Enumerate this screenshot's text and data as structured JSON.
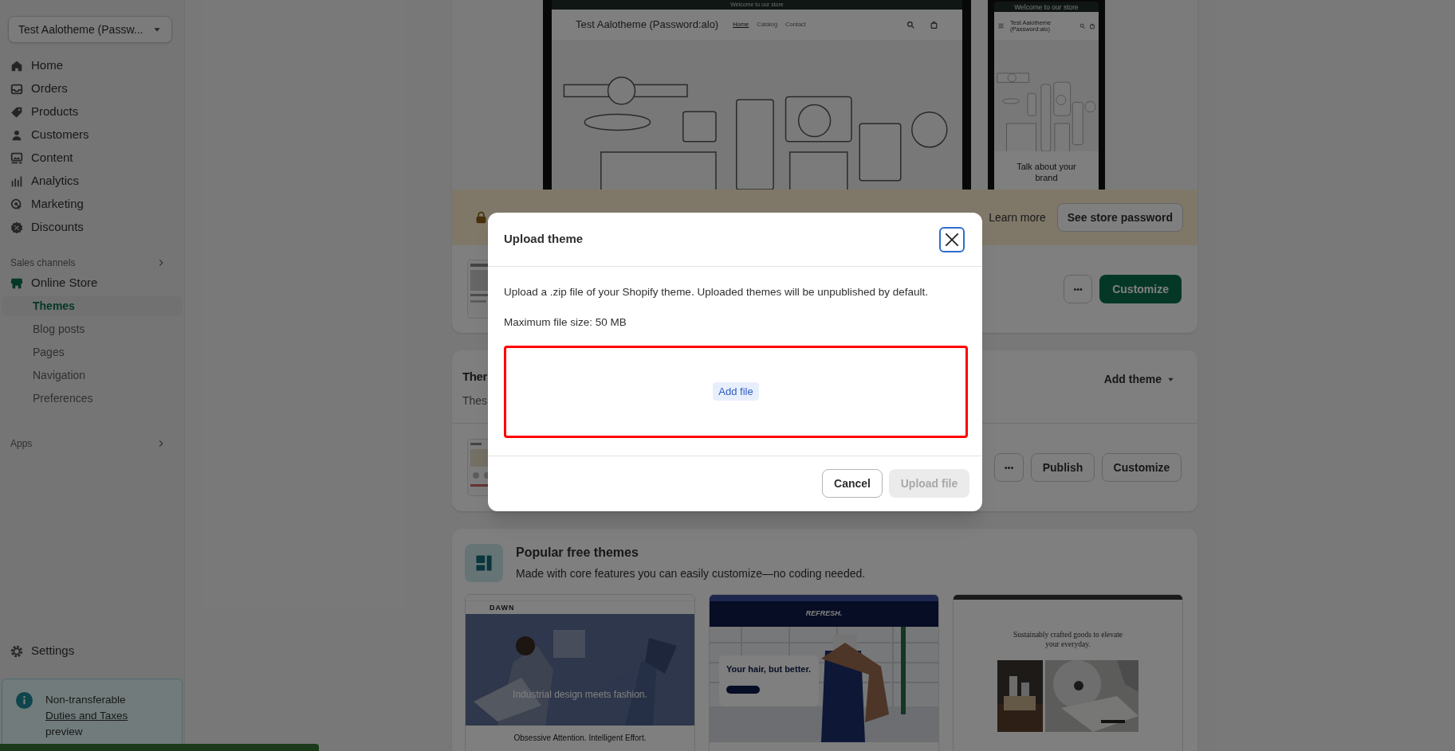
{
  "store_switcher": {
    "label": "Test Aalotheme (Passw..."
  },
  "nav": [
    {
      "label": "Home"
    },
    {
      "label": "Orders"
    },
    {
      "label": "Products"
    },
    {
      "label": "Customers"
    },
    {
      "label": "Content"
    },
    {
      "label": "Analytics"
    },
    {
      "label": "Marketing"
    },
    {
      "label": "Discounts"
    }
  ],
  "sales_channels": {
    "label": "Sales channels",
    "channel": "Online Store",
    "items": [
      {
        "label": "Themes",
        "selected": true
      },
      {
        "label": "Blog posts",
        "selected": false
      },
      {
        "label": "Pages",
        "selected": false
      },
      {
        "label": "Navigation",
        "selected": false
      },
      {
        "label": "Preferences",
        "selected": false
      }
    ]
  },
  "apps": {
    "label": "Apps"
  },
  "settings": {
    "label": "Settings"
  },
  "notice": {
    "line1": "Non-transferable",
    "link": "Duties and Taxes",
    "line3": "preview"
  },
  "preview": {
    "announcement": "Welcome to our store",
    "store_name": "Test Aalotheme (Password:alo)",
    "links": [
      {
        "label": "Home",
        "selected": true
      },
      {
        "label": "Catalog",
        "selected": false
      },
      {
        "label": "Contact",
        "selected": false
      }
    ],
    "mobile_announcement": "Welcome to our store",
    "mobile_store_name": "Test Aalotheme (Password:alo)",
    "mobile_heading": "Talk about your brand"
  },
  "banner": {
    "learn_more": "Learn more",
    "button": "See store password"
  },
  "current_theme": {
    "more": "•••",
    "customize": "Customize"
  },
  "theme_library": {
    "title": "Ther",
    "subtitle": "Thes",
    "add_theme": "Add theme",
    "more": "•••",
    "publish": "Publish",
    "customize": "Customize"
  },
  "popular": {
    "title": "Popular free themes",
    "subtitle": "Made with core features you can easily customize—no coding needed.",
    "themes": [
      {
        "kind": "dawn",
        "logo": "DAWN",
        "headline": "Industrial design meets fashion.",
        "tagline": "Obsessive Attention. Intelligent Effort."
      },
      {
        "kind": "refresh",
        "logo": "REFRESH.",
        "headline": "Your hair, but better."
      },
      {
        "kind": "crafted",
        "headline": "Sustainably crafted goods to elevate your everyday."
      }
    ]
  },
  "modal": {
    "title": "Upload theme",
    "description": "Upload a .zip file of your Shopify theme. Uploaded themes will be unpublished by default.",
    "max_size": "Maximum file size: 50 MB",
    "add_file": "Add file",
    "cancel": "Cancel",
    "upload": "Upload file",
    "upload_disabled": true
  }
}
